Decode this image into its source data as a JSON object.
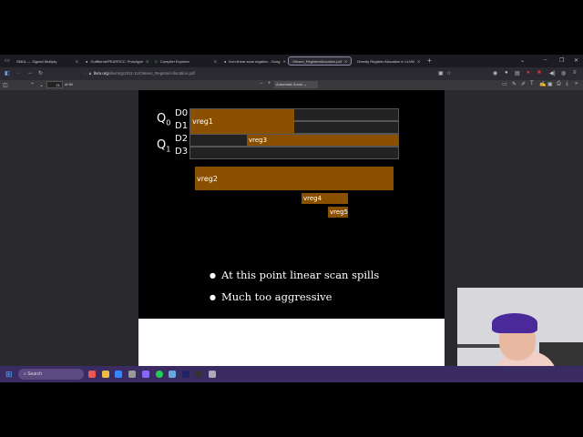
{
  "browser": {
    "tabs": [
      {
        "title": "SMUL — Signed Multiply"
      },
      {
        "title": "GuilBernd/PEARSCC: Prototype"
      },
      {
        "title": "Compiler Explorer"
      },
      {
        "title": "llvm linear scan regalloc - Goog"
      },
      {
        "title": "Olesen_RegisterAllocation.pdf",
        "active": true
      },
      {
        "title": "Greedy Register Allocation in LLVM"
      }
    ],
    "new_tab": "+",
    "url_domain": "llvm.org",
    "url_path": "/devmtg/2011-11/Olesen_RegisterAllocation.pdf"
  },
  "pdf_toolbar": {
    "page_number": "21",
    "page_count": "of 60",
    "zoom": "Automatic Zoom",
    "zoom_out": "−",
    "zoom_in": "+"
  },
  "slide": {
    "registers": {
      "q0": "Q",
      "q0_sub": "0",
      "q1": "Q",
      "q1_sub": "1",
      "d": [
        "D0",
        "D1",
        "D2",
        "D3"
      ]
    },
    "bars": {
      "vreg1": "vreg1",
      "vreg2": "vreg2",
      "vreg3": "vreg3",
      "vreg4": "vreg4",
      "vreg5": "vreg5"
    },
    "bullets": [
      "At this point linear scan spills",
      "Much too aggressive"
    ],
    "bar_color": "#8a5000"
  },
  "taskbar": {
    "search": "Search"
  }
}
